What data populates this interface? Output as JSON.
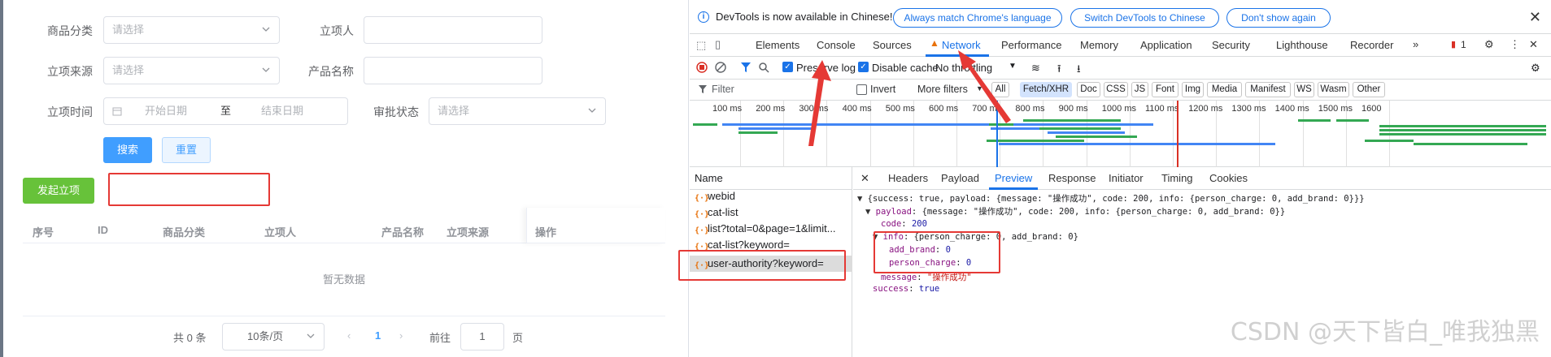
{
  "filters": {
    "category_label": "商品分类",
    "category_placeholder": "请选择",
    "initiator_label": "立项人",
    "source_label": "立项来源",
    "source_placeholder": "请选择",
    "product_label": "产品名称",
    "time_label": "立项时间",
    "start_placeholder": "开始日期",
    "range_sep": "至",
    "end_placeholder": "结束日期",
    "approval_label": "审批状态",
    "approval_placeholder": "请选择",
    "search_button": "搜索",
    "reset_button": "重置"
  },
  "actions": {
    "create_button": "发起立项"
  },
  "table": {
    "columns": [
      "序号",
      "ID",
      "商品分类",
      "立项人",
      "产品名称",
      "立项来源",
      "操作"
    ],
    "empty_text": "暂无数据"
  },
  "pagination": {
    "total_text": "共 0 条",
    "page_size": "10条/页",
    "current_page": "1",
    "goto_label": "前往",
    "goto_value": "1",
    "page_suffix": "页"
  },
  "devtools": {
    "info_text": "DevTools is now available in Chinese!",
    "info_buttons": [
      "Always match Chrome's language",
      "Switch DevTools to Chinese",
      "Don't show again"
    ],
    "tabs": [
      "Elements",
      "Console",
      "Sources",
      "Network",
      "Performance",
      "Memory",
      "Application",
      "Security",
      "Lighthouse",
      "Recorder"
    ],
    "active_tab": "Network",
    "more_tabs": "»",
    "issues_count": "1",
    "preserve_log": "Preserve log",
    "disable_cache": "Disable cache",
    "throttling": "No throttling",
    "filter_placeholder": "Filter",
    "invert": "Invert",
    "more_filters": "More filters",
    "type_filters": [
      "All",
      "Fetch/XHR",
      "Doc",
      "CSS",
      "JS",
      "Font",
      "Img",
      "Media",
      "Manifest",
      "WS",
      "Wasm",
      "Other"
    ],
    "selected_type": "Fetch/XHR",
    "timeline_ticks": [
      "100 ms",
      "200 ms",
      "300 ms",
      "400 ms",
      "500 ms",
      "600 ms",
      "700 ms",
      "800 ms",
      "900 ms",
      "1000 ms",
      "1100 ms",
      "1200 ms",
      "1300 ms",
      "1400 ms",
      "1500 ms",
      "1600"
    ],
    "name_header": "Name",
    "requests": [
      "webid",
      "cat-list",
      "list?total=0&page=1&limit...",
      "cat-list?keyword=",
      "user-authority?keyword="
    ],
    "selected_request": "user-authority?keyword=",
    "detail_tabs": [
      "Headers",
      "Payload",
      "Preview",
      "Response",
      "Initiator",
      "Timing",
      "Cookies"
    ],
    "active_detail_tab": "Preview",
    "preview": {
      "line1": "{success: true, payload: {message: \"操作成功\", code: 200, info: {person_charge: 0, add_brand: 0}}}",
      "line2_key": "payload",
      "line2_val": "{message: \"操作成功\", code: 200, info: {person_charge: 0, add_brand: 0}}",
      "code_key": "code",
      "code_val": "200",
      "info_key": "info",
      "info_val": "{person_charge: 0, add_brand: 0}",
      "add_brand_key": "add_brand",
      "add_brand_val": "0",
      "person_charge_key": "person_charge",
      "person_charge_val": "0",
      "message_key": "message",
      "message_val": "\"操作成功\"",
      "success_key": "success",
      "success_val": "true"
    },
    "watermark": "CSDN @天下皆白_唯我独黑"
  },
  "colors": {
    "primary": "#409eff",
    "green": "#67c23a",
    "annotation_red": "#e53935",
    "devtools_blue": "#1a73e8"
  }
}
